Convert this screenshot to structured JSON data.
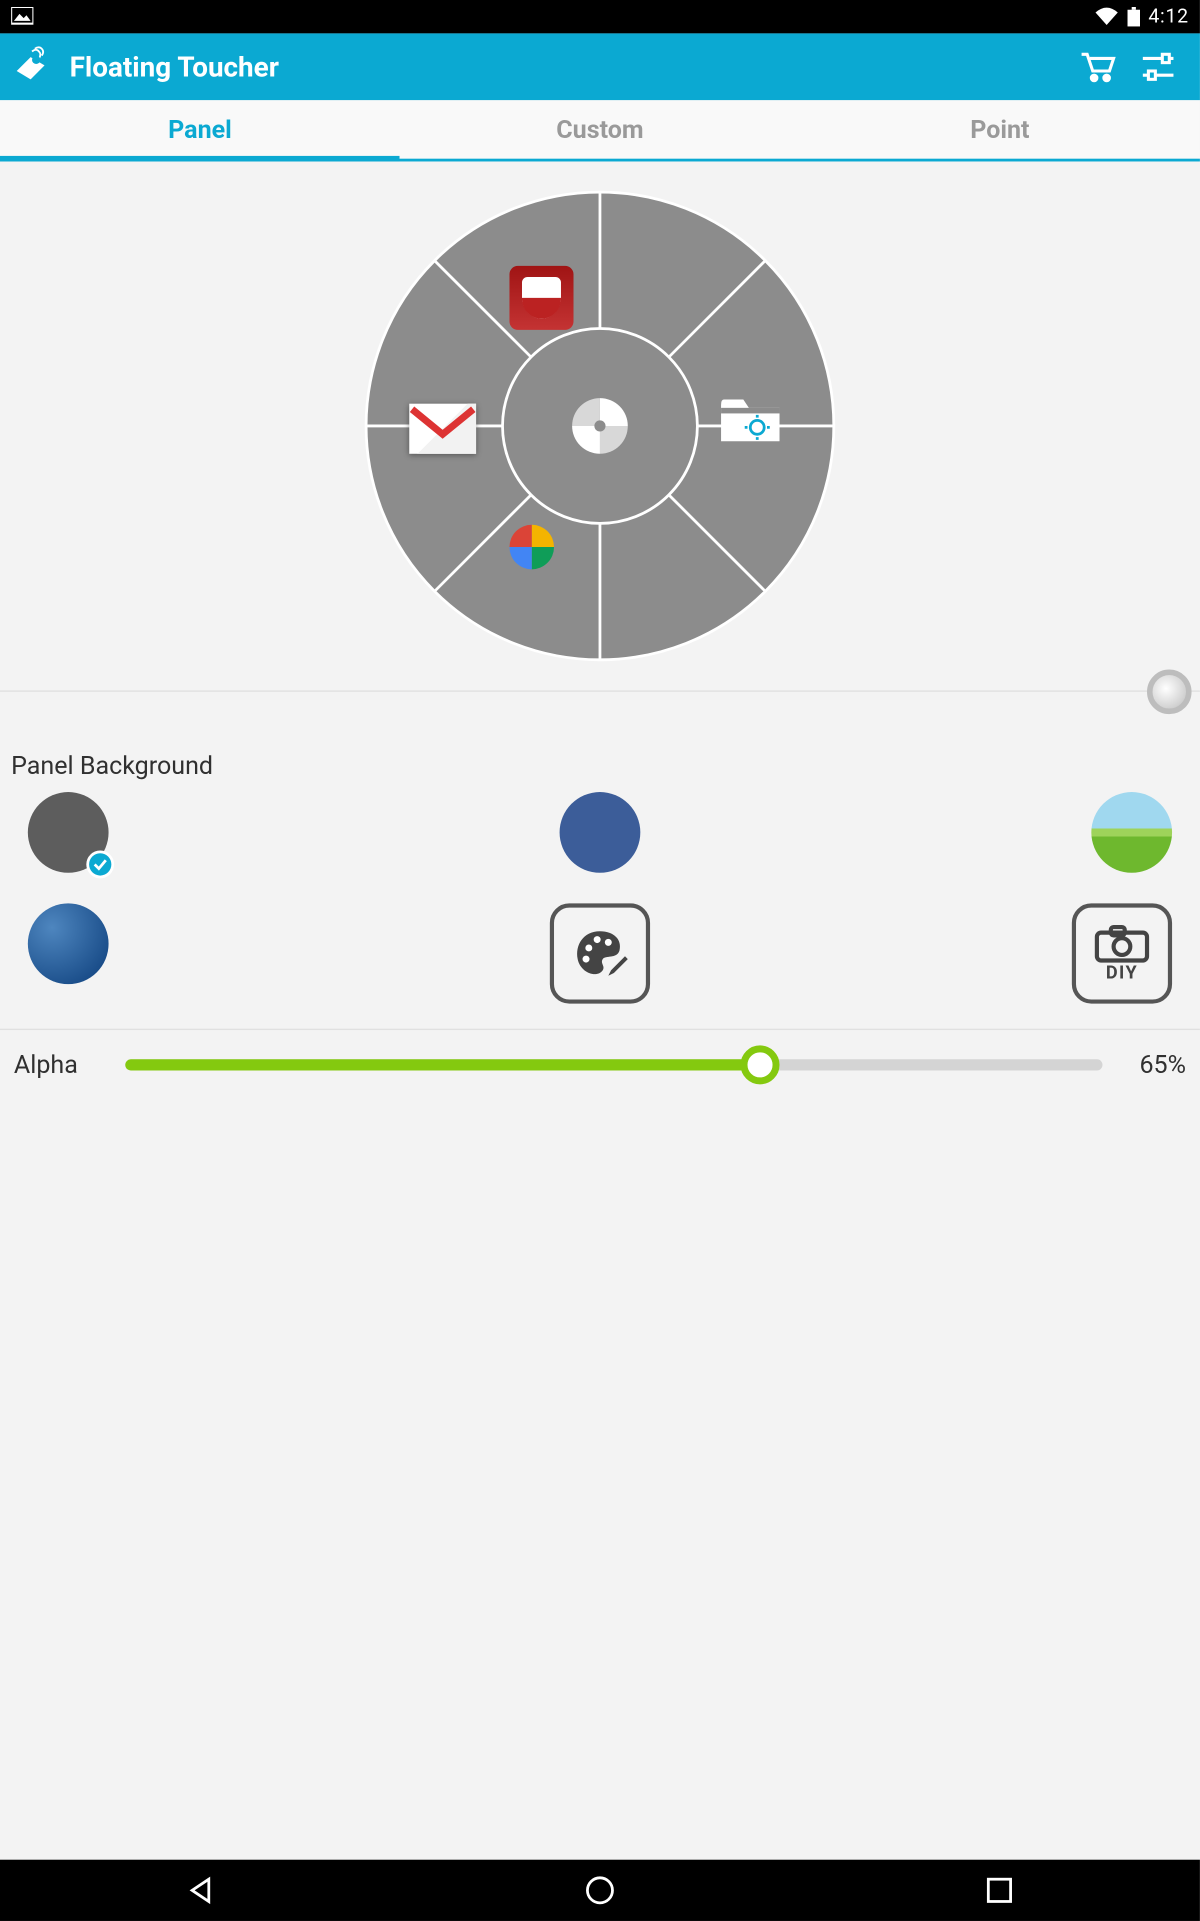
{
  "status": {
    "time": "4:12"
  },
  "app": {
    "title": "Floating Toucher"
  },
  "tabs": {
    "items": [
      "Panel",
      "Custom",
      "Point"
    ],
    "active_index": 0
  },
  "wheel": {
    "segments": 8,
    "apps": [
      {
        "slot": 1,
        "name": "nfl-icon"
      },
      {
        "slot": 2,
        "name": "gmail-icon"
      },
      {
        "slot": 3,
        "name": "photos-icon"
      },
      {
        "slot": 7,
        "name": "settings-folder-icon"
      }
    ]
  },
  "panel_background": {
    "title": "Panel Background",
    "options": [
      {
        "id": "gray",
        "selected": true
      },
      {
        "id": "blue",
        "selected": false
      },
      {
        "id": "landscape",
        "selected": false
      },
      {
        "id": "stars",
        "selected": false
      },
      {
        "id": "palette",
        "selected": false
      },
      {
        "id": "diy-camera",
        "selected": false
      }
    ]
  },
  "alpha": {
    "label": "Alpha",
    "value": 65,
    "display": "65%"
  },
  "diy_label": "DIY"
}
